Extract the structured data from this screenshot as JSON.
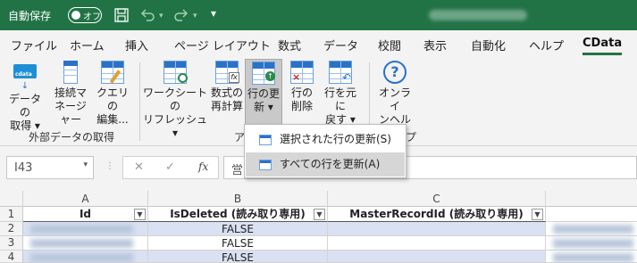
{
  "titlebar": {
    "autosave_label": "自動保存",
    "toggle_state": "オフ",
    "more_icon": "▾"
  },
  "menu": {
    "tabs": [
      "ファイル",
      "ホーム",
      "挿入",
      "ページ レイアウト",
      "数式",
      "データ",
      "校閲",
      "表示",
      "自動化",
      "ヘルプ",
      "CData"
    ],
    "active": "CData"
  },
  "ribbon": {
    "buttons": {
      "get_data": [
        "データの",
        "取得 ▾"
      ],
      "connection_manager": [
        "接続マ",
        "ネージャー"
      ],
      "query_editor": [
        "クエリの",
        "編集..."
      ],
      "worksheet_refresh": [
        "ワークシートの",
        "リフレッシュ ▾"
      ],
      "formula_recalc": [
        "数式の",
        "再計算"
      ],
      "update_rows": [
        "行の更",
        "新 ▾"
      ],
      "delete_rows": [
        "行の",
        "削除"
      ],
      "revert_rows": [
        "行を元に",
        "戻す ▾"
      ],
      "online_help": [
        "オンライ",
        "ンヘルプ"
      ]
    },
    "groups": {
      "external_data": "外部データの取得",
      "actions_partial": "ア",
      "help_partial": "プ"
    }
  },
  "dropdown": {
    "items": [
      "選択された行の更新(S)",
      "すべての行を更新(A)"
    ]
  },
  "formula_bar": {
    "name_box": "I43",
    "cancel_icon": "✕",
    "enter_icon": "✓",
    "fx_label": "fx",
    "content_partial": "営"
  },
  "sheet": {
    "columns": [
      "A",
      "B",
      "C"
    ],
    "row_numbers": [
      "1",
      "2",
      "3",
      "4"
    ],
    "headers": [
      "Id",
      "IsDeleted (読み取り専用)",
      "MasterRecordId (読み取り専用)"
    ],
    "rows": [
      [
        "",
        "FALSE",
        ""
      ],
      [
        "",
        "FALSE",
        ""
      ],
      [
        "",
        "FALSE",
        ""
      ]
    ]
  },
  "colors": {
    "excel_green": "#217346",
    "accent_blue": "#2a72c8",
    "row_band": "#d9e1f2"
  }
}
